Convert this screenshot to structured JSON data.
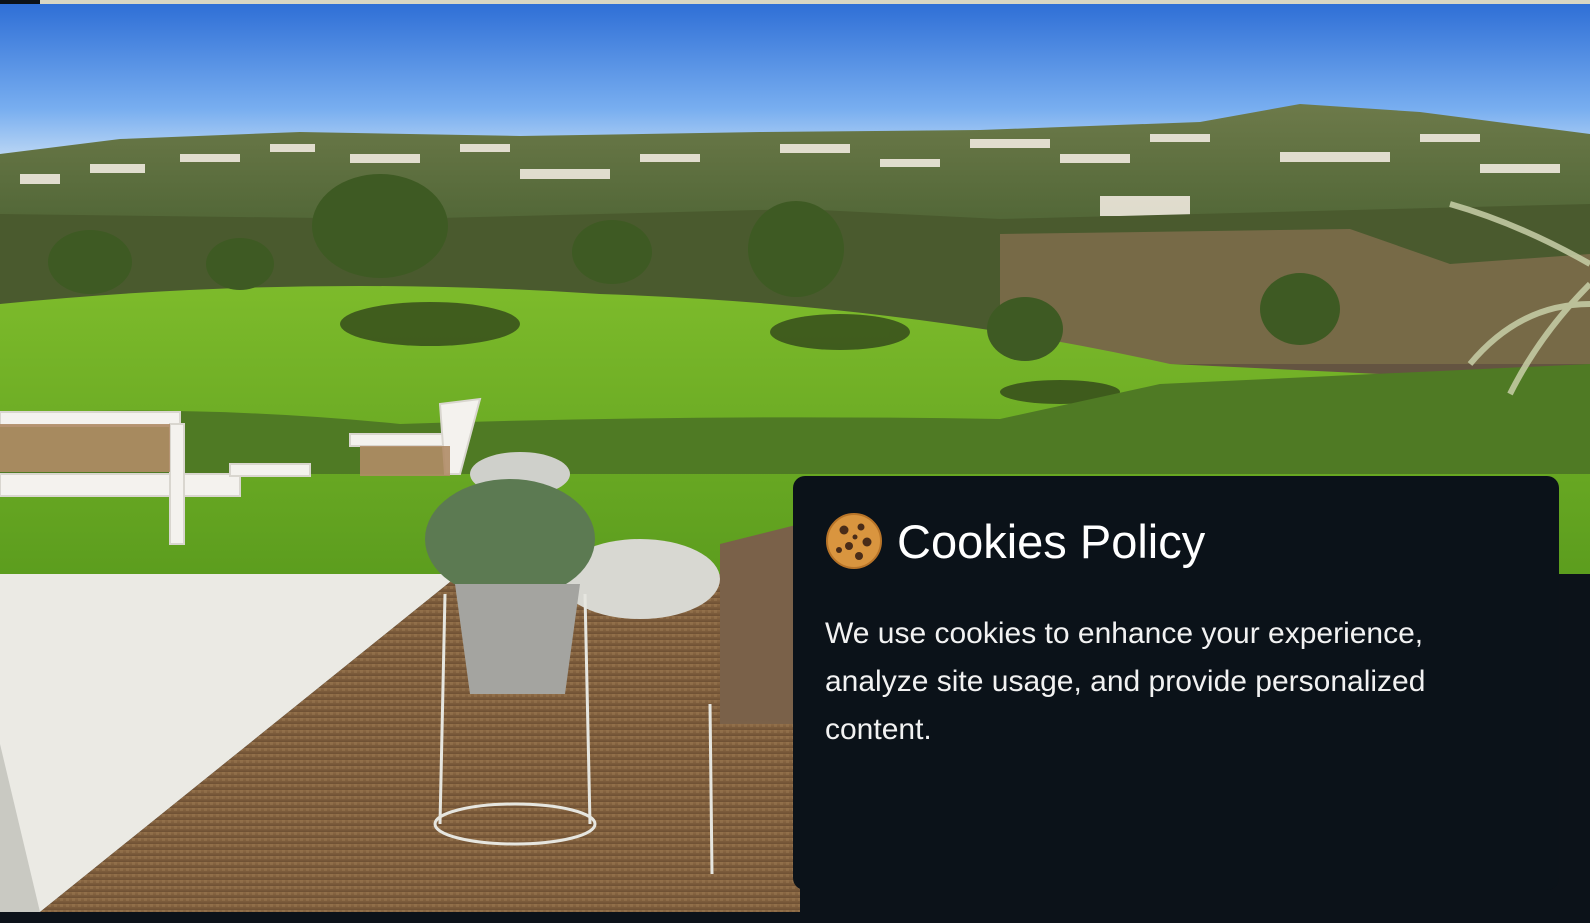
{
  "cookie_banner": {
    "icon": "cookie-icon",
    "title": "Cookies Policy",
    "message": "We use cookies to enhance your experience, analyze site usage, and provide personalized content."
  },
  "hero": {
    "image": "golf-course-terrace-view"
  },
  "colors": {
    "panel_bg": "#0b1219",
    "page_bg": "#0c1219",
    "text": "#ffffff"
  }
}
